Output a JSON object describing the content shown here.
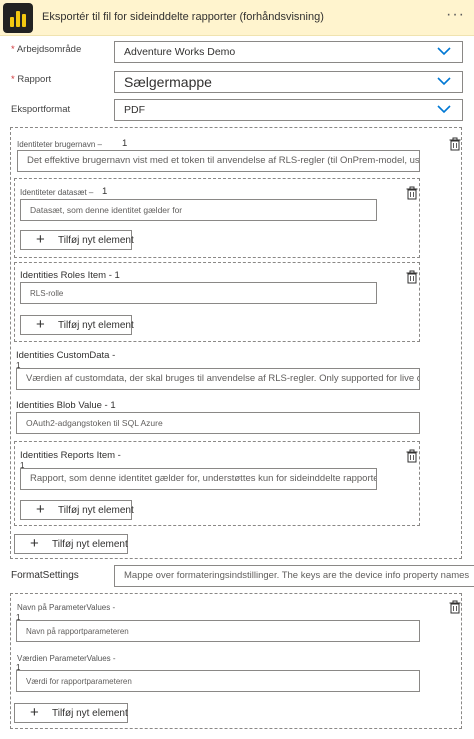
{
  "header": {
    "title": "Eksportér til fil for sideinddelte rapporter (forhåndsvisning)",
    "more": "···"
  },
  "fields": {
    "workspace": {
      "label": "Arbejdsområde",
      "value": "Adventure Works Demo"
    },
    "report": {
      "label": "Rapport",
      "value": "Sælgermappe"
    },
    "format": {
      "label": "Eksportformat",
      "value": "PDF"
    }
  },
  "required_mark": "*",
  "identities": {
    "username": {
      "label": "Identiteter brugernavn –",
      "count": "1",
      "placeholder": "Det effektive brugernavn vist med et token til anvendelse af RLS-regler (til OnPrem-model, userr"
    },
    "dataset": {
      "label": "Identiteter datasæt –",
      "count": "1",
      "placeholder": "Datasæt, som denne identitet gælder for",
      "add": "Tilføj nyt element"
    },
    "roles": {
      "label": "Identities Roles Item -",
      "count": "1",
      "placeholder": "RLS-rolle",
      "add": "Tilføj nyt element"
    },
    "customdata": {
      "label": "Identities CustomData -",
      "count": "1",
      "placeholder": "Værdien af customdata, der skal bruges til anvendelse af RLS-regler. Only supported for live connectic"
    },
    "blob": {
      "label": "Identities Blob Value -",
      "count": "1",
      "placeholder": "OAuth2-adgangstoken til SQL Azure"
    },
    "reports": {
      "label": "Identities Reports Item -",
      "count": "1",
      "placeholder": "Rapport, som denne identitet gælder for, understøttes kun for sideinddelte rapporter",
      "add": "Tilføj nyt element"
    },
    "add": "Tilføj nyt element"
  },
  "format_settings": {
    "label": "FormatSettings",
    "placeholder": "Mappe over formateringsindstillinger. The keys are the device info property names"
  },
  "parameters": {
    "name": {
      "label": "Navn på ParameterValues",
      "count": "1",
      "placeholder": "Navn på rapportparameteren"
    },
    "value": {
      "label": "Værdien ParameterValues",
      "count": "1",
      "placeholder": "Værdi for rapportparameteren"
    },
    "add": "Tilføj nyt element"
  },
  "colors": {
    "header_bg": "#fff4ce",
    "chevron": "#0078d4",
    "required": "#d13438",
    "logo": "#f2c811"
  },
  "icons": {
    "more": "more-icon",
    "chevron": "chevron-down-icon",
    "delete": "delete-icon",
    "add": "plus-icon",
    "logo": "powerbi-icon"
  }
}
